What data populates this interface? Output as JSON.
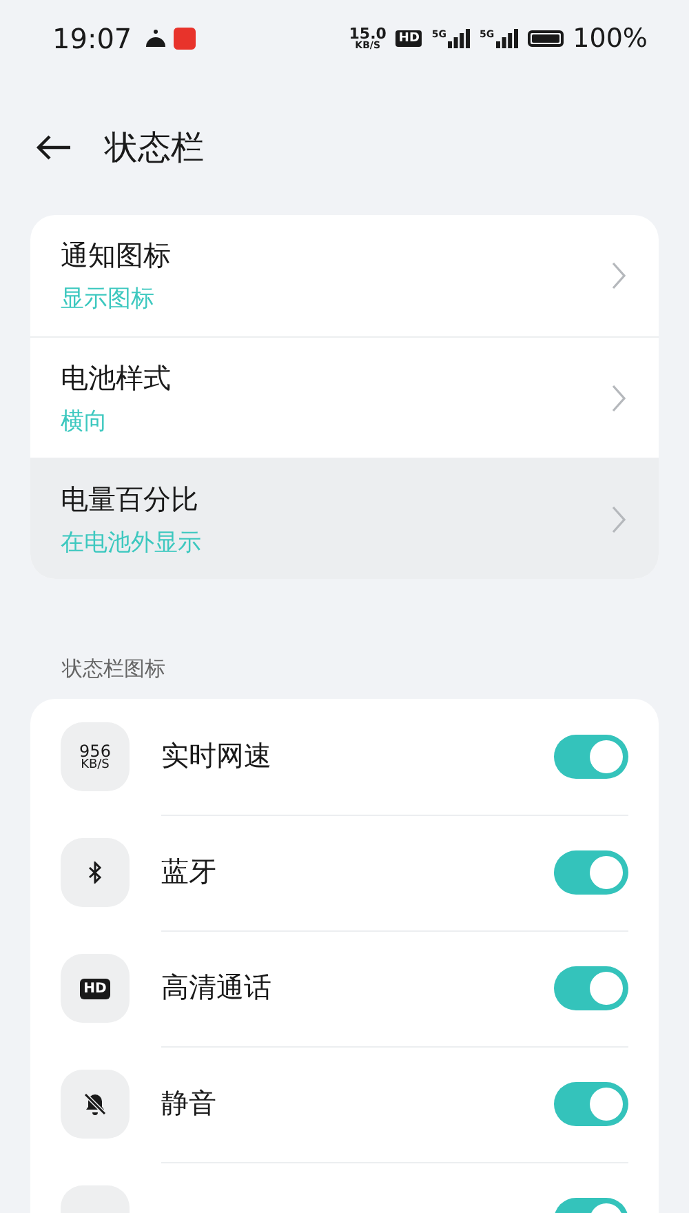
{
  "status_bar": {
    "time": "19:07",
    "net_speed": {
      "value": "15.0",
      "unit": "KB/S"
    },
    "hd_label": "HD",
    "sim_labels": [
      "5G",
      "5G"
    ],
    "battery_text": "100%"
  },
  "header": {
    "title": "状态栏"
  },
  "settings": [
    {
      "title": "通知图标",
      "value": "显示图标",
      "highlighted": false
    },
    {
      "title": "电池样式",
      "value": "横向",
      "highlighted": false
    },
    {
      "title": "电量百分比",
      "value": "在电池外显示",
      "highlighted": true
    }
  ],
  "section": {
    "title": "状态栏图标"
  },
  "icons": [
    {
      "kind": "speed",
      "icon_text": [
        "956",
        "KB/S"
      ],
      "label": "实时网速",
      "on": true
    },
    {
      "kind": "bluetooth",
      "label": "蓝牙",
      "on": true
    },
    {
      "kind": "hd",
      "icon_text": [
        "HD"
      ],
      "label": "高清通话",
      "on": true
    },
    {
      "kind": "mute",
      "label": "静音",
      "on": true
    },
    {
      "kind": "partial",
      "on": true
    }
  ]
}
